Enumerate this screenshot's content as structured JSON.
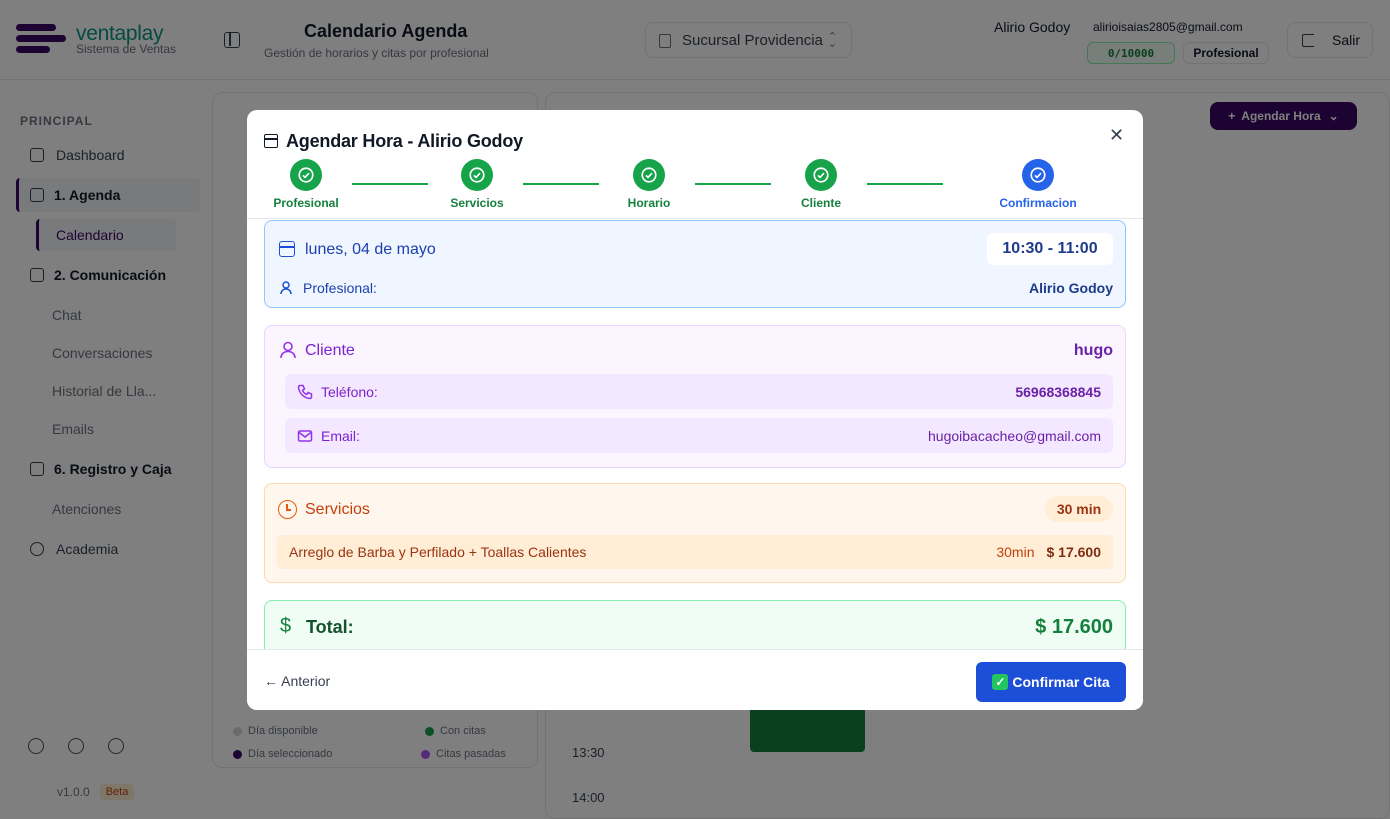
{
  "app": {
    "brand": "ventaplay",
    "brand_sub": "Sistema de Ventas"
  },
  "header": {
    "title": "Calendario Agenda",
    "subtitle": "Gestión de horarios y citas por profesional",
    "branch": "Sucursal Providencia",
    "user_name": "Alirio Godoy",
    "user_email": "alirioisaias2805@gmail.com",
    "quota": "0/10000",
    "role": "Profesional",
    "logout": "Salir"
  },
  "sidebar": {
    "section": "PRINCIPAL",
    "items": [
      {
        "label": "Dashboard"
      },
      {
        "label": "1. Agenda"
      },
      {
        "label": "Calendario"
      },
      {
        "label": "2. Comunicación"
      },
      {
        "label": "Chat"
      },
      {
        "label": "Conversaciones"
      },
      {
        "label": "Historial de Lla..."
      },
      {
        "label": "Emails"
      },
      {
        "label": "6. Registro y Caja"
      },
      {
        "label": "Atenciones"
      },
      {
        "label": "Academia"
      }
    ],
    "version": "v1.0.0",
    "beta": "Beta"
  },
  "background": {
    "agendar_hora": "Agendar Hora",
    "legend": [
      "Día disponible",
      "Con citas",
      "Día seleccionado",
      "Citas pasadas"
    ],
    "times": [
      "13:30",
      "14:00"
    ]
  },
  "modal": {
    "title": "Agendar Hora - Alirio Godoy",
    "steps": [
      {
        "label": "Profesional",
        "status": "done"
      },
      {
        "label": "Servicios",
        "status": "done"
      },
      {
        "label": "Horario",
        "status": "done"
      },
      {
        "label": "Cliente",
        "status": "done"
      },
      {
        "label": "Confirmacion",
        "status": "current"
      }
    ],
    "date": "lunes, 04 de mayo",
    "time_range": "10:30 - 11:00",
    "professional_label": "Profesional:",
    "professional_name": "Alirio Godoy",
    "client": {
      "title": "Cliente",
      "name": "hugo",
      "phone_label": "Teléfono:",
      "phone": "56968368845",
      "email_label": "Email:",
      "email": "hugoibacacheo@gmail.com"
    },
    "services": {
      "title": "Servicios",
      "total_duration": "30 min",
      "items": [
        {
          "name": "Arreglo de Barba y Perfilado + Toallas Calientes",
          "duration": "30min",
          "price": "$ 17.600"
        }
      ]
    },
    "total_label": "Total:",
    "total_value": "$ 17.600",
    "prev_button": "← Anterior",
    "confirm_button": "Confirmar Cita"
  },
  "colors": {
    "brand": "#3b0764",
    "step_done": "#16a34a",
    "step_current": "#2563eb",
    "confirm": "#1d4ed8"
  }
}
